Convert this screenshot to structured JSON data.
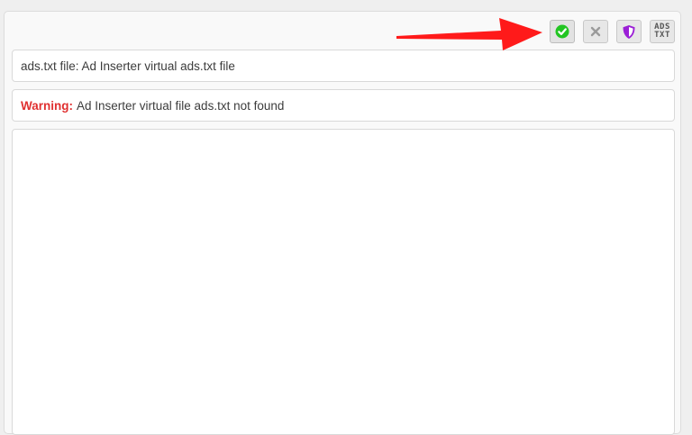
{
  "toolbar": {
    "buttons": [
      {
        "name": "check-icon",
        "color": "#22c522"
      },
      {
        "name": "close-icon",
        "color": "#9a9a9a"
      },
      {
        "name": "shield-icon",
        "color": "#9b1fd6"
      },
      {
        "name": "ads-txt-icon",
        "line1": "ADS",
        "line2": "TXT"
      }
    ]
  },
  "file_info": {
    "text": "ads.txt file: Ad Inserter virtual ads.txt file"
  },
  "warning": {
    "label": "Warning:",
    "message": "Ad Inserter virtual file ads.txt not found",
    "color": "#e03030"
  },
  "annotation": {
    "arrow_color": "#ff1a1a"
  }
}
